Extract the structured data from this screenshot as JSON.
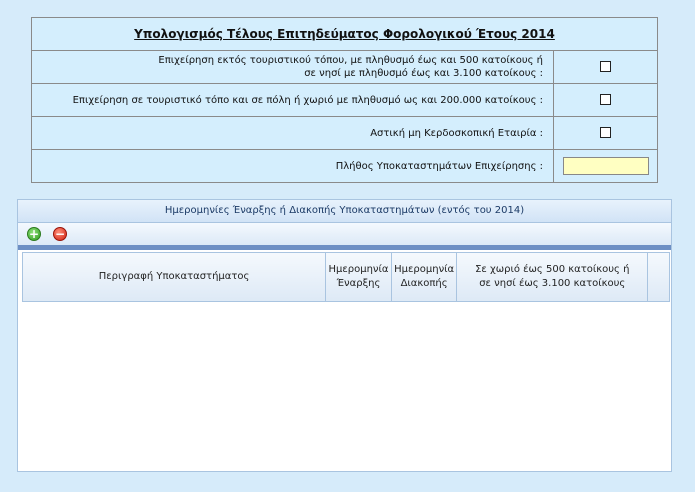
{
  "form": {
    "title": "Υπολογισμός Τέλους Επιτηδεύματος Φορολογικού Έτους 2014",
    "rows": [
      {
        "label_line1": "Επιχείρηση εκτός τουριστικού τόπου, με πληθυσμό έως και 500 κατοίκους ή",
        "label_line2": "σε νησί με πληθυσμό έως και 3.100 κατοίκους :"
      },
      {
        "label": "Επιχείρηση σε τουριστικό τόπο και σε πόλη ή χωριό με πληθυσμό ως και 200.000 κατοίκους :"
      },
      {
        "label": "Αστική μη Κερδοσκοπική Εταιρία :"
      },
      {
        "label": "Πλήθος Υποκαταστημάτων Επιχείρησης :",
        "value": ""
      }
    ]
  },
  "panel": {
    "title": "Ημερομηνίες Έναρξης ή Διακοπής Υποκαταστημάτων (εντός του 2014)",
    "add_symbol": "+",
    "remove_symbol": "−",
    "columns": [
      {
        "line1": "Περιγραφή Υποκαταστήματος"
      },
      {
        "line1": "Ημερομηνία",
        "line2": "Έναρξης"
      },
      {
        "line1": "Ημερομηνία",
        "line2": "Διακοπής"
      },
      {
        "line1": "Σε χωριό έως 500 κατοίκους ή",
        "line2": "σε νησί έως 3.100 κατοίκους"
      }
    ]
  }
}
